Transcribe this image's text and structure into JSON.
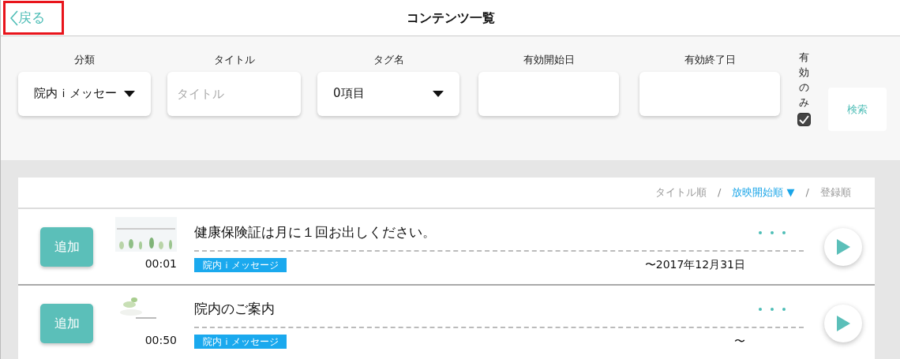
{
  "header": {
    "back": "戻る",
    "title": "コンテンツ一覧"
  },
  "filters": [
    {
      "kind": "select",
      "label": "分類",
      "value": "院内ｉメッセー"
    },
    {
      "kind": "text",
      "label": "タイトル",
      "placeholder": "タイトル"
    },
    {
      "kind": "select",
      "label": "タグ名",
      "value": "0項目"
    },
    {
      "kind": "date",
      "label": "有効開始日"
    },
    {
      "kind": "date",
      "label": "有効終了日"
    }
  ],
  "valid_only": {
    "label": "有効のみ",
    "checked": true
  },
  "search_button": "検索",
  "sort": {
    "items": [
      {
        "label": "タイトル順",
        "selected": false
      },
      {
        "label": "放映開始順 ▼",
        "selected": true
      },
      {
        "label": "登録順",
        "selected": false
      }
    ],
    "separators": [
      "/",
      "/"
    ]
  },
  "rows": [
    {
      "add_button": "追加",
      "duration": "00:01",
      "title": "健康保険証は月に１回お出しください。",
      "tag": "院内ｉメッセージ",
      "period": "〜2017年12月31日"
    },
    {
      "add_button": "追加",
      "duration": "00:50",
      "title": "院内のご案内",
      "tag": "院内ｉメッセージ",
      "period": "〜"
    }
  ]
}
